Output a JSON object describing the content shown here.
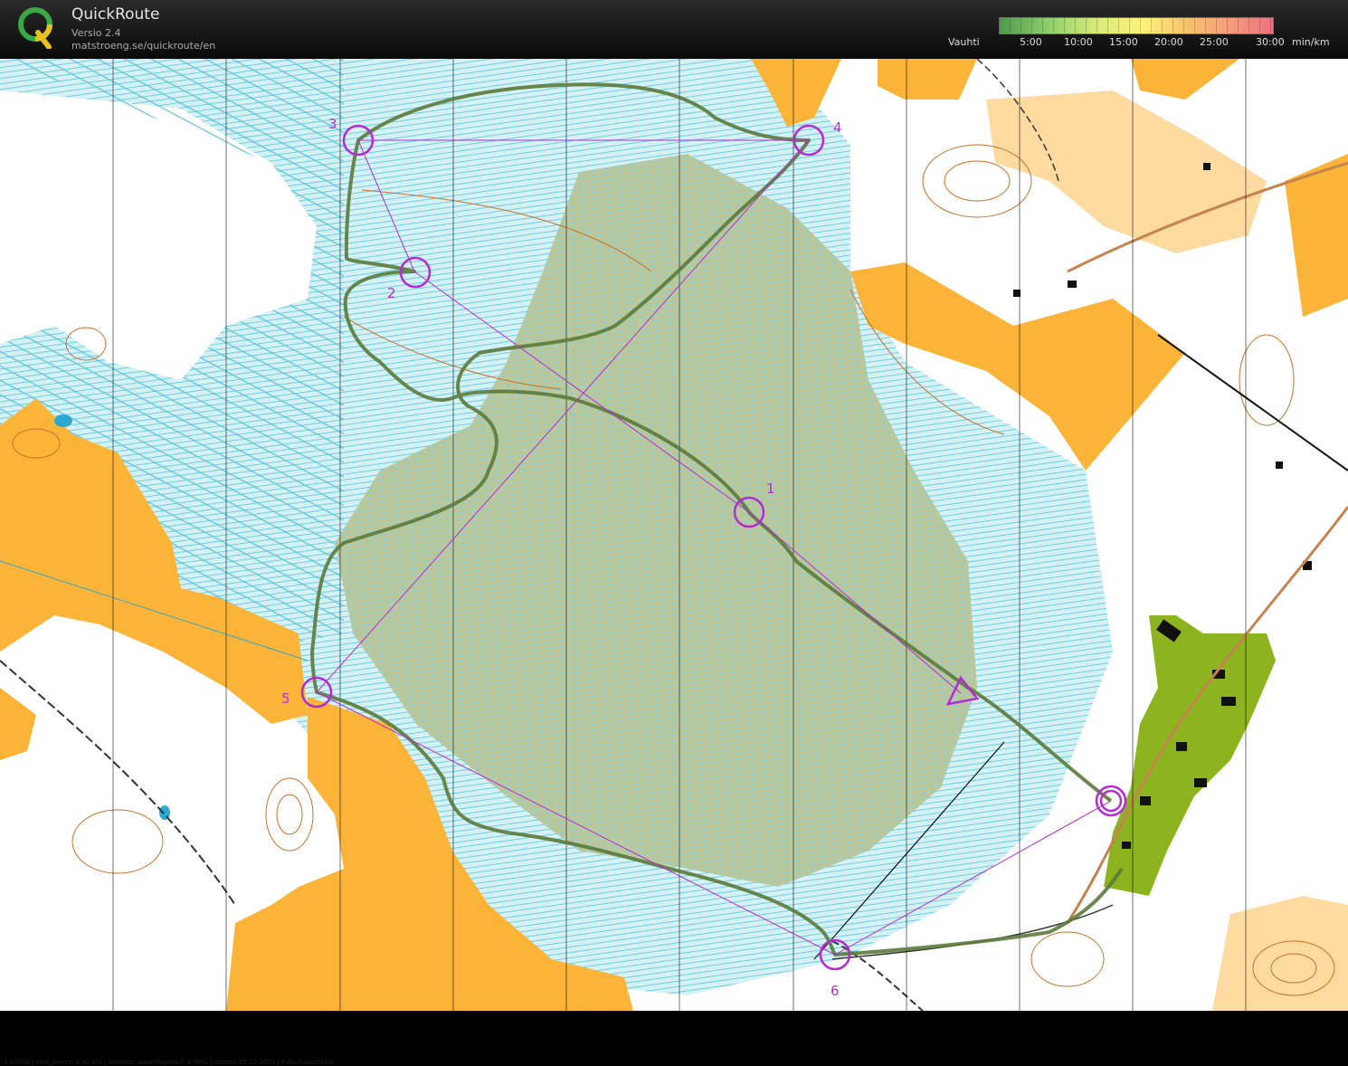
{
  "header": {
    "app_name": "QuickRoute",
    "version": "Versio 2.4",
    "url": "matstroeng.se/quickroute/en"
  },
  "pace_legend": {
    "label": "Vauhti",
    "ticks": [
      "5:00",
      "10:00",
      "15:00",
      "20:00",
      "25:00",
      "30:00"
    ],
    "unit": "min/km",
    "colors": [
      "#4e9a4e",
      "#8fcf6a",
      "#d6ea78",
      "#fff37a",
      "#f8c46a",
      "#f59a7a",
      "#f07080"
    ]
  },
  "map": {
    "footer_text": "1:10000 | rata_piirros: 6.42 km | Aineisto: www.MapAnt.fi & MML | ladattu 26.12.2020 | Pulautuskartta.fi",
    "controls": [
      {
        "id": "start",
        "label": ""
      },
      {
        "id": "1",
        "label": "1"
      },
      {
        "id": "2",
        "label": "2"
      },
      {
        "id": "3",
        "label": "3"
      },
      {
        "id": "4",
        "label": "4"
      },
      {
        "id": "5",
        "label": "5"
      },
      {
        "id": "6",
        "label": "6"
      },
      {
        "id": "finish",
        "label": ""
      }
    ],
    "colors": {
      "open_land": "#fbb437",
      "marsh": "#a8e4ee",
      "swamp_forest": "#b3b58a",
      "buildings_green": "#8cb41e",
      "course": "#b52bd2",
      "route": "#5b7a3a",
      "contour": "#c8702a"
    }
  }
}
